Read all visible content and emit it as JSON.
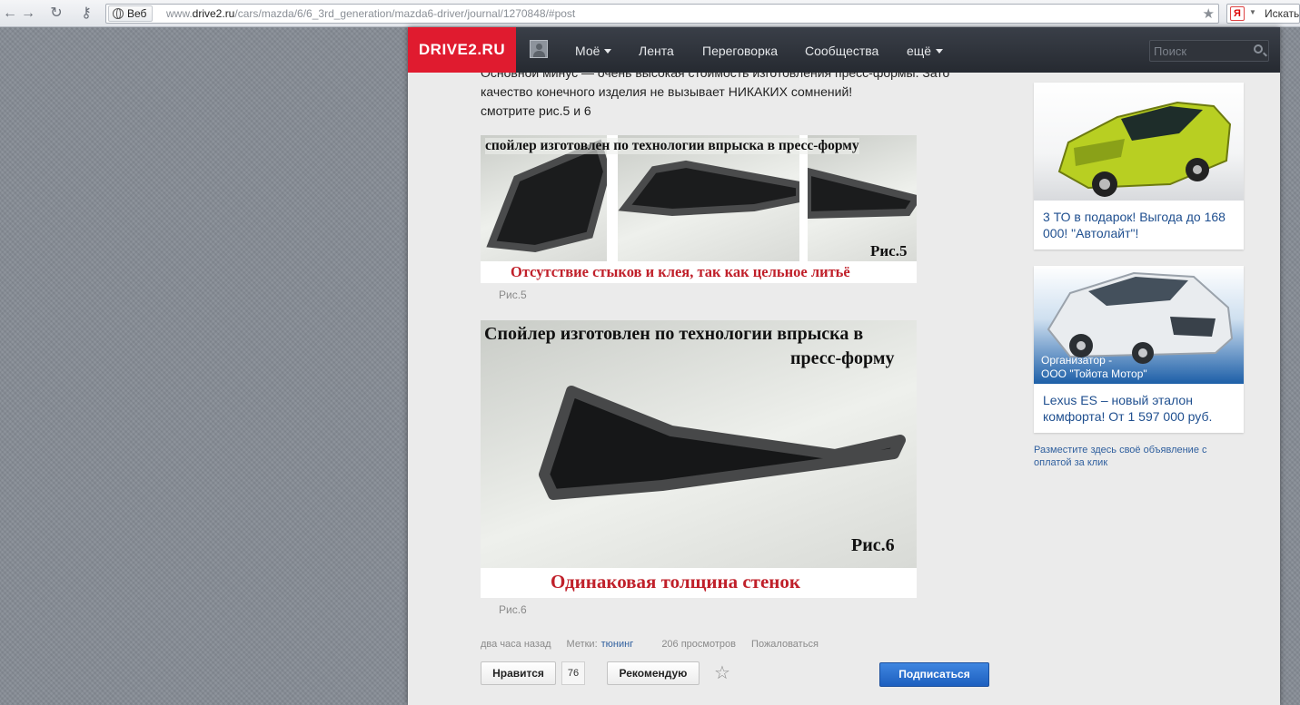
{
  "browser": {
    "chip_label": "Веб",
    "url_prefix": "www.",
    "url_domain": "drive2.ru",
    "url_path": "/cars/mazda/6/6_3rd_generation/mazda6-driver/journal/1270848/#post",
    "search_label": "Искать"
  },
  "nav": {
    "logo": "DRIVE2.RU",
    "items": [
      "Моё",
      "Лента",
      "Переговорка",
      "Сообщества",
      "ещё"
    ],
    "search_placeholder": "Поиск"
  },
  "article": {
    "lines": [
      "Основной минус — очень высокая стоимость изготовления пресс-формы. Зато",
      "качество конечного изделия не вызывает НИКАКИХ сомнений!",
      "смотрите рис.5 и 6"
    ],
    "figures": [
      {
        "title": "спойлер изготовлен по технологии впрыска в пресс-форму",
        "label": "Рис.5",
        "caption": "Отсутствие стыков и клея, так как цельное литьё",
        "sub_caption": "Рис.5"
      },
      {
        "title_line1": "Спойлер изготовлен по технологии впрыска в",
        "title_line2": "пресс-форму",
        "label": "Рис.6",
        "caption": "Одинаковая  толщина  стенок",
        "sub_caption": "Рис.6"
      }
    ],
    "meta": {
      "time": "два часа назад",
      "tags_label": "Метки:",
      "tag": "тюнинг",
      "views": "206 просмотров",
      "report": "Пожаловаться"
    },
    "actions": {
      "like": "Нравится",
      "like_count": "76",
      "recommend": "Рекомендую",
      "subscribe": "Подписаться"
    }
  },
  "ads": [
    {
      "text": "3 ТО в подарок! Выгода до 168 000! \"Автолайт\"!",
      "car_color": "#b8cf22"
    },
    {
      "org_line1": "Организатор -",
      "org_line2": "ООО \"Тойота Мотор\"",
      "text": "Lexus ES – новый эталон комфорта! От 1 597 000 руб.",
      "car_color": "#e9ecef"
    }
  ],
  "place_ad": "Разместите здесь своё объявление с оплатой за клик"
}
